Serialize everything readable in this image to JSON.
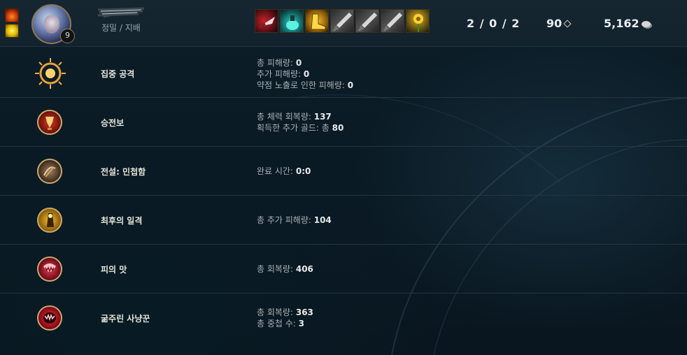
{
  "header": {
    "rune_paths": "정밀 / 지배",
    "champion_level": "9",
    "kda": "2 / 0 / 2",
    "cs": "90",
    "gold": "5,162",
    "items": [
      {
        "icon": "red-dagger-item-icon"
      },
      {
        "icon": "cyan-potion-item-icon"
      },
      {
        "icon": "golden-boots-item-icon"
      },
      {
        "icon": "long-sword-item-icon"
      },
      {
        "icon": "long-sword-item-icon"
      },
      {
        "icon": "long-sword-item-icon"
      },
      {
        "icon": "yellow-flower-trinket-icon"
      }
    ],
    "summoner_spells": [
      "ignite-spell-icon",
      "flash-spell-icon"
    ]
  },
  "runes": [
    {
      "name": "집중 공격",
      "icon": "press-the-attack-icon",
      "stats": [
        {
          "label": "총 피해량: ",
          "value": "0"
        },
        {
          "label": "추가 피해량: ",
          "value": "0"
        },
        {
          "label": "약점 노출로 인한 피해량: ",
          "value": "0"
        }
      ]
    },
    {
      "name": "승전보",
      "icon": "triumph-icon",
      "stats": [
        {
          "label": "총 체력 회복량: ",
          "value": "137"
        },
        {
          "label": "획득한 추가 골드: 총 ",
          "value": "80"
        }
      ]
    },
    {
      "name": "전설: 민첩함",
      "icon": "legend-alacrity-icon",
      "stats": [
        {
          "label": "완료 시간: ",
          "value": "0:0"
        }
      ]
    },
    {
      "name": "최후의 일격",
      "icon": "coup-de-grace-icon",
      "stats": [
        {
          "label": "총 추가 피해량: ",
          "value": "104"
        }
      ]
    },
    {
      "name": "피의 맛",
      "icon": "taste-of-blood-icon",
      "stats": [
        {
          "label": "총 회복량: ",
          "value": "406"
        }
      ]
    },
    {
      "name": "굶주린 사냥꾼",
      "icon": "ravenous-hunter-icon",
      "stats": [
        {
          "label": "총 회복량: ",
          "value": "363"
        },
        {
          "label": "총 중첩 수: ",
          "value": "3"
        }
      ]
    }
  ]
}
